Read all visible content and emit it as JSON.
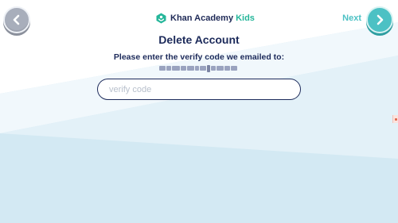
{
  "header": {
    "logo": {
      "icon": "khan-academy-hexagon-icon",
      "brand": "Khan Academy",
      "product": "Kids"
    },
    "back_icon": "chevron-left-icon",
    "next_label": "Next",
    "next_icon": "chevron-right-icon"
  },
  "main": {
    "title": "Delete Account",
    "instruction": "Please enter the verify code we emailed to:",
    "verify_input": {
      "value": "",
      "placeholder": "verify code"
    }
  },
  "colors": {
    "navy": "#1c2a5a",
    "teal": "#4cc1c4",
    "green": "#25b69a",
    "back_button": "#a8aebb",
    "background_light": "#e8f4fa",
    "background_mid": "#d6ebf5"
  }
}
